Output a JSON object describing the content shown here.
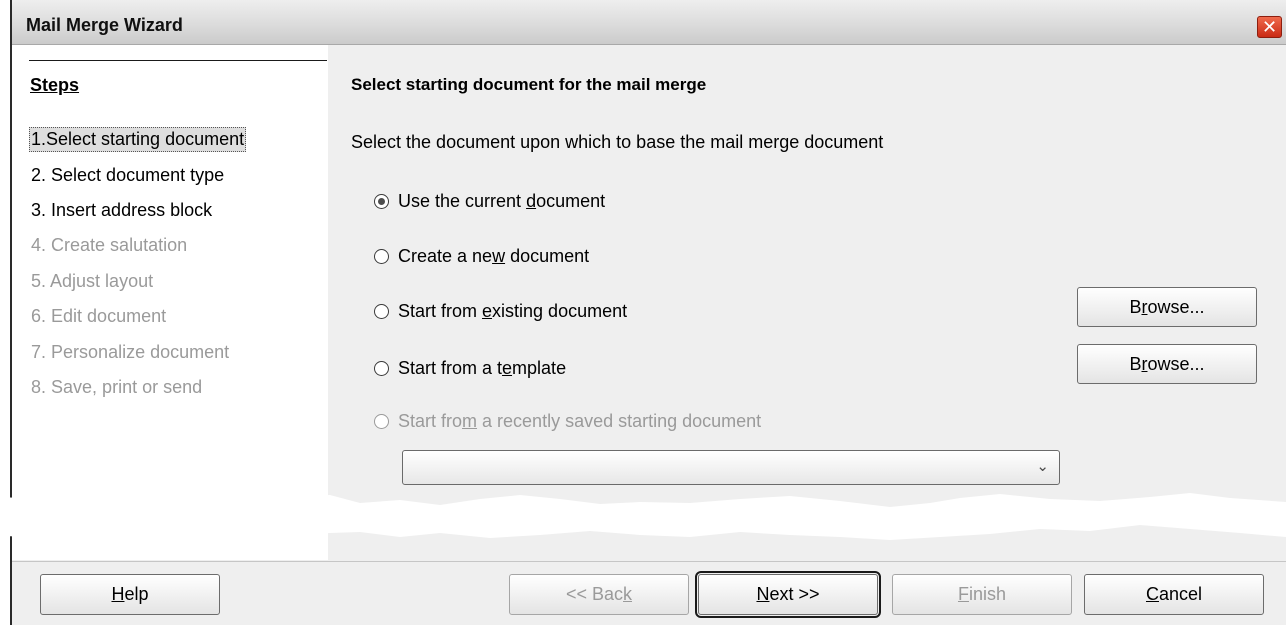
{
  "window": {
    "title": "Mail Merge Wizard",
    "close_glyph": "✕"
  },
  "steps": {
    "header": "Steps",
    "items": [
      {
        "number": "1.",
        "label": "Select starting document",
        "state": "current"
      },
      {
        "number": "2.",
        "label": "Select document type",
        "state": "enabled"
      },
      {
        "number": "3.",
        "label": "Insert address block",
        "state": "enabled"
      },
      {
        "number": "4.",
        "label": "Create salutation",
        "state": "disabled"
      },
      {
        "number": "5.",
        "label": "Adjust layout",
        "state": "disabled"
      },
      {
        "number": "6.",
        "label": "Edit document",
        "state": "disabled"
      },
      {
        "number": "7.",
        "label": "Personalize document",
        "state": "disabled"
      },
      {
        "number": "8.",
        "label": "Save, print or send",
        "state": "disabled"
      }
    ]
  },
  "content": {
    "title": "Select starting document for the mail merge",
    "description": "Select the document upon which to base the mail merge document",
    "options": [
      {
        "pre": "Use the current ",
        "acc": "d",
        "post": "ocument",
        "checked": true,
        "disabled": false
      },
      {
        "pre": "Create a ne",
        "acc": "w",
        "post": " document",
        "checked": false,
        "disabled": false
      },
      {
        "pre": "Start from ",
        "acc": "e",
        "post": "xisting document",
        "checked": false,
        "disabled": false
      },
      {
        "pre": "Start from a t",
        "acc": "e",
        "post": "mplate",
        "checked": false,
        "disabled": false
      },
      {
        "pre": "Start fro",
        "acc": "m",
        "post": " a recently saved starting document",
        "checked": false,
        "disabled": true
      }
    ],
    "browse": {
      "pre": "B",
      "acc": "r",
      "post": "owse..."
    },
    "recent_combo": {
      "value": "",
      "arrow_glyph": "⌄"
    }
  },
  "buttons": {
    "help": {
      "pre": "",
      "acc": "H",
      "post": "elp",
      "disabled": false
    },
    "back": {
      "pre": "<< Bac",
      "acc": "k",
      "post": "",
      "disabled": true
    },
    "next": {
      "pre": "",
      "acc": "N",
      "post": "ext >>",
      "disabled": false
    },
    "finish": {
      "pre": "",
      "acc": "F",
      "post": "inish",
      "disabled": true
    },
    "cancel": {
      "pre": "",
      "acc": "C",
      "post": "ancel",
      "disabled": false
    }
  }
}
